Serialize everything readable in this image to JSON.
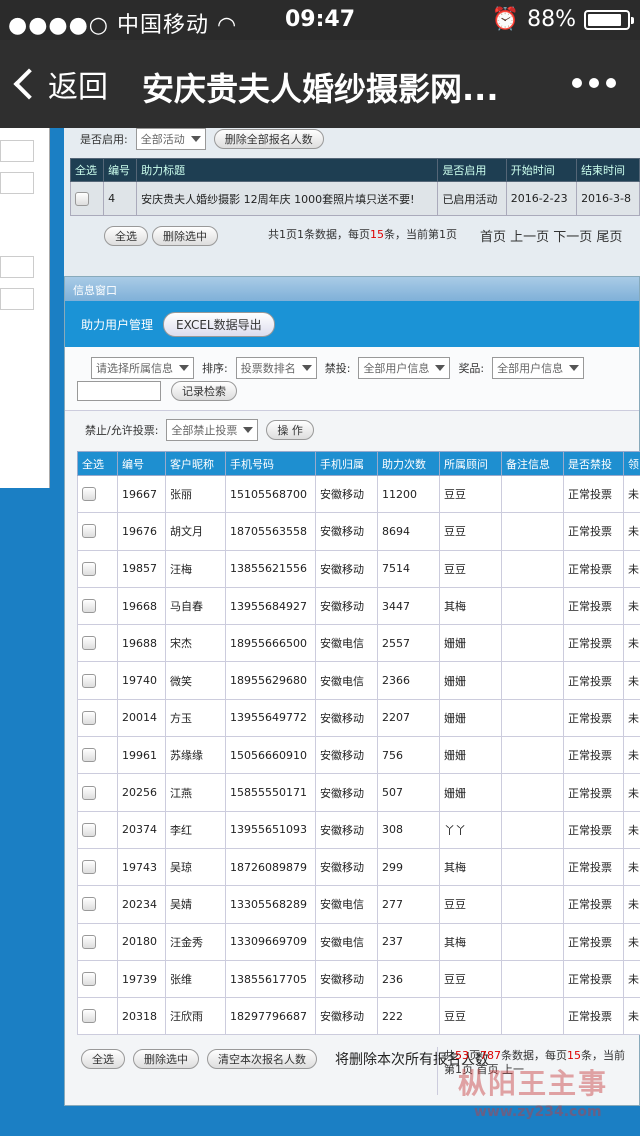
{
  "status_bar": {
    "signal": "●●●●○",
    "carrier": "中国移动",
    "wifi": "wifi-icon",
    "time": "09:47",
    "alarm": "alarm-icon",
    "battery_percent": "88%",
    "battery_level": 0.88
  },
  "nav": {
    "back_label": "返回",
    "title": "安庆贵夫人婚纱摄影网...",
    "more_icon": "more-icon"
  },
  "background": {
    "enabled_label": "是否启用:",
    "enabled_value": "全部活动",
    "delete_all_label": "删除全部报名人数",
    "headers": [
      "全选",
      "编号",
      "助力标题",
      "是否启用",
      "开始时间",
      "结束时间"
    ],
    "row": {
      "id": "4",
      "title": "安庆贵夫人婚纱摄影 12周年庆 1000套照片填只送不要!",
      "status": "已启用活动",
      "start": "2016-2-23",
      "end": "2016-3-8"
    },
    "select_all": "全选",
    "delete_selected": "删除选中",
    "summary_pre": "共1页1条数据，每页",
    "summary_per": "15",
    "summary_post": "条，当前第1页",
    "pager": "首页 上一页 下一页 尾页"
  },
  "window": {
    "title": "信息窗口",
    "heading": "助力用户管理",
    "export_label": "EXCEL数据导出",
    "filter_group": "请选择所属信息",
    "sort_label": "排序:",
    "sort_value": "投票数排名",
    "ban_label": "禁投:",
    "ban_value": "全部用户信息",
    "prize_label": "奖品:",
    "prize_value": "全部用户信息",
    "search_button": "记录检索",
    "allow_label": "禁止/允许投票:",
    "allow_value": "全部禁止投票",
    "action_button": "操 作",
    "headers": [
      "全选",
      "编号",
      "客户昵称",
      "手机号码",
      "手机归属",
      "助力次数",
      "所属顾问",
      "备注信息",
      "是否禁投",
      "领"
    ],
    "rows": [
      {
        "id": "19667",
        "name": "张丽",
        "phone": "15105568700",
        "carrier": "安徽移动",
        "count": "11200",
        "advisor": "豆豆",
        "note": "",
        "status": "正常投票",
        "extra": "未"
      },
      {
        "id": "19676",
        "name": "胡文月",
        "phone": "18705563558",
        "carrier": "安徽移动",
        "count": "8694",
        "advisor": "豆豆",
        "note": "",
        "status": "正常投票",
        "extra": "未"
      },
      {
        "id": "19857",
        "name": "汪梅",
        "phone": "13855621556",
        "carrier": "安徽移动",
        "count": "7514",
        "advisor": "豆豆",
        "note": "",
        "status": "正常投票",
        "extra": "未"
      },
      {
        "id": "19668",
        "name": "马自春",
        "phone": "13955684927",
        "carrier": "安徽移动",
        "count": "3447",
        "advisor": "其梅",
        "note": "",
        "status": "正常投票",
        "extra": "未"
      },
      {
        "id": "19688",
        "name": "宋杰",
        "phone": "18955666500",
        "carrier": "安徽电信",
        "count": "2557",
        "advisor": "姗姗",
        "note": "",
        "status": "正常投票",
        "extra": "未"
      },
      {
        "id": "19740",
        "name": "微笑",
        "phone": "18955629680",
        "carrier": "安徽电信",
        "count": "2366",
        "advisor": "姗姗",
        "note": "",
        "status": "正常投票",
        "extra": "未"
      },
      {
        "id": "20014",
        "name": "方玉",
        "phone": "13955649772",
        "carrier": "安徽移动",
        "count": "2207",
        "advisor": "姗姗",
        "note": "",
        "status": "正常投票",
        "extra": "未"
      },
      {
        "id": "19961",
        "name": "苏缘缘",
        "phone": "15056660910",
        "carrier": "安徽移动",
        "count": "756",
        "advisor": "姗姗",
        "note": "",
        "status": "正常投票",
        "extra": "未"
      },
      {
        "id": "20256",
        "name": "江燕",
        "phone": "15855550171",
        "carrier": "安徽移动",
        "count": "507",
        "advisor": "姗姗",
        "note": "",
        "status": "正常投票",
        "extra": "未"
      },
      {
        "id": "20374",
        "name": "李红",
        "phone": "13955651093",
        "carrier": "安徽移动",
        "count": "308",
        "advisor": "丫丫",
        "note": "",
        "status": "正常投票",
        "extra": "未"
      },
      {
        "id": "19743",
        "name": "吴琼",
        "phone": "18726089879",
        "carrier": "安徽移动",
        "count": "299",
        "advisor": "其梅",
        "note": "",
        "status": "正常投票",
        "extra": "未"
      },
      {
        "id": "20234",
        "name": "吴婧",
        "phone": "13305568289",
        "carrier": "安徽电信",
        "count": "277",
        "advisor": "豆豆",
        "note": "",
        "status": "正常投票",
        "extra": "未"
      },
      {
        "id": "20180",
        "name": "汪金秀",
        "phone": "13309669709",
        "carrier": "安徽电信",
        "count": "237",
        "advisor": "其梅",
        "note": "",
        "status": "正常投票",
        "extra": "未"
      },
      {
        "id": "19739",
        "name": "张维",
        "phone": "13855617705",
        "carrier": "安徽移动",
        "count": "236",
        "advisor": "豆豆",
        "note": "",
        "status": "正常投票",
        "extra": "未"
      },
      {
        "id": "20318",
        "name": "汪欣雨",
        "phone": "18297796687",
        "carrier": "安徽移动",
        "count": "222",
        "advisor": "豆豆",
        "note": "",
        "status": "正常投票",
        "extra": "未"
      }
    ],
    "footer": {
      "select_all": "全选",
      "delete_selected": "删除选中",
      "clear_label": "清空本次报名人数",
      "delete_note": "将删除本次所有报名人数",
      "total_pre": "共",
      "total_pages": "53",
      "total_mid": "页",
      "total_rows": "787",
      "total_post": "条数据，每页",
      "per_page": "15",
      "current": "条，当前第1页",
      "pager": "首页 上一"
    }
  },
  "watermark": {
    "text": "枞阳王主事",
    "url": "www.zy234.com"
  }
}
